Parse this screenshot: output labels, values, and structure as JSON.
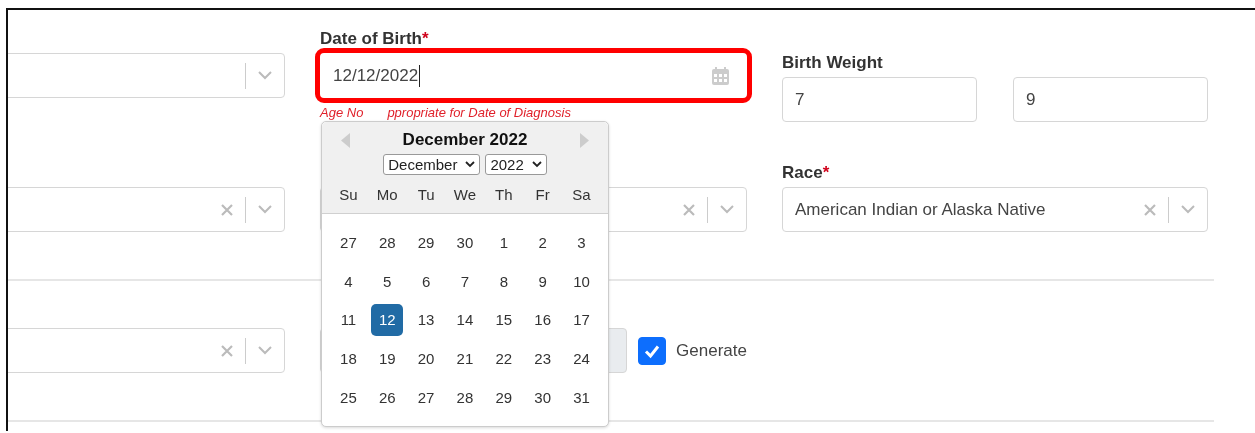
{
  "left_selects": [
    {
      "clearable": false
    },
    {
      "clearable": true
    },
    {
      "clearable": true
    }
  ],
  "date_of_birth": {
    "label": "Date of Birth",
    "required_mark": "*",
    "value": "12/12/2022",
    "highlighted": true,
    "error_parts": [
      "Age No",
      "ppropriate for Date of Diagnosis"
    ]
  },
  "birth_weight": {
    "label": "Birth Weight",
    "values": [
      "7",
      "9"
    ]
  },
  "middle_select": {
    "clearable": true
  },
  "race": {
    "label": "Race",
    "required_mark": "*",
    "value": "American Indian or Alaska Native",
    "clearable": true
  },
  "locked_input": {
    "disabled": true
  },
  "generate": {
    "label": "Generate",
    "checked": true
  },
  "calendar": {
    "title": "December 2022",
    "month": "December",
    "year": "2022",
    "weekdays": [
      "Su",
      "Mo",
      "Tu",
      "We",
      "Th",
      "Fr",
      "Sa"
    ],
    "weeks": [
      [
        {
          "day": "27",
          "selected": false
        },
        {
          "day": "28",
          "selected": false
        },
        {
          "day": "29",
          "selected": false
        },
        {
          "day": "30",
          "selected": false
        },
        {
          "day": "1",
          "selected": false
        },
        {
          "day": "2",
          "selected": false
        },
        {
          "day": "3",
          "selected": false
        }
      ],
      [
        {
          "day": "4",
          "selected": false
        },
        {
          "day": "5",
          "selected": false
        },
        {
          "day": "6",
          "selected": false
        },
        {
          "day": "7",
          "selected": false
        },
        {
          "day": "8",
          "selected": false
        },
        {
          "day": "9",
          "selected": false
        },
        {
          "day": "10",
          "selected": false
        }
      ],
      [
        {
          "day": "11",
          "selected": false
        },
        {
          "day": "12",
          "selected": true
        },
        {
          "day": "13",
          "selected": false
        },
        {
          "day": "14",
          "selected": false
        },
        {
          "day": "15",
          "selected": false
        },
        {
          "day": "16",
          "selected": false
        },
        {
          "day": "17",
          "selected": false
        }
      ],
      [
        {
          "day": "18",
          "selected": false
        },
        {
          "day": "19",
          "selected": false
        },
        {
          "day": "20",
          "selected": false
        },
        {
          "day": "21",
          "selected": false
        },
        {
          "day": "22",
          "selected": false
        },
        {
          "day": "23",
          "selected": false
        },
        {
          "day": "24",
          "selected": false
        }
      ],
      [
        {
          "day": "25",
          "selected": false
        },
        {
          "day": "26",
          "selected": false
        },
        {
          "day": "27",
          "selected": false
        },
        {
          "day": "28",
          "selected": false
        },
        {
          "day": "29",
          "selected": false
        },
        {
          "day": "30",
          "selected": false
        },
        {
          "day": "31",
          "selected": false
        }
      ]
    ]
  }
}
